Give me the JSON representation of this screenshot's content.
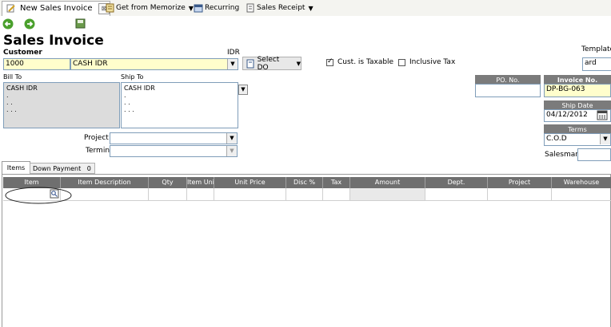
{
  "tab": {
    "title": "New Sales Invoice",
    "close": "⊠"
  },
  "toolbar": {
    "memorize": "Get from Memorize",
    "recurring": "Recurring",
    "sales_receipt": "Sales Receipt"
  },
  "form": {
    "title": "Sales Invoice",
    "customer_label": "Customer",
    "customer_code": "1000",
    "customer_name": "CASH IDR",
    "currency": "IDR",
    "select_do": "Select DO",
    "taxable_label": "Cust. is Taxable",
    "taxable_checked": true,
    "inclusive_label": "Inclusive Tax",
    "inclusive_checked": false,
    "template_label": "Template",
    "template_value": "ard",
    "bill_to_label": "Bill To",
    "ship_to_label": "Ship To",
    "bill_to_text": "CASH IDR\n.\n. .\n. . .",
    "ship_to_text": "CASH IDR\n.\n. .\n. . .",
    "project_label": "Project",
    "termin_label": "Termin",
    "po_label": "PO. No.",
    "po_value": "",
    "invoice_label": "Invoice No.",
    "invoice_value": "DP-BG-063",
    "ship_date_label": "Ship Date",
    "ship_date_value": "04/12/2012",
    "terms_label": "Terms",
    "terms_value": "C.O.D",
    "salesman_label": "Salesman",
    "salesman_value": ""
  },
  "tabs": {
    "items": "Items",
    "down_payment": "Down Payment",
    "down_payment_count": "0"
  },
  "grid": {
    "columns": [
      "Item",
      "Item Description",
      "Qty",
      "Item Unit",
      "Unit Price",
      "Disc %",
      "Tax",
      "Amount",
      "Dept.",
      "Project",
      "Warehouse"
    ]
  },
  "colors": {
    "accent_yellow": "#fffecc",
    "header_gray": "#7b7b7b"
  }
}
